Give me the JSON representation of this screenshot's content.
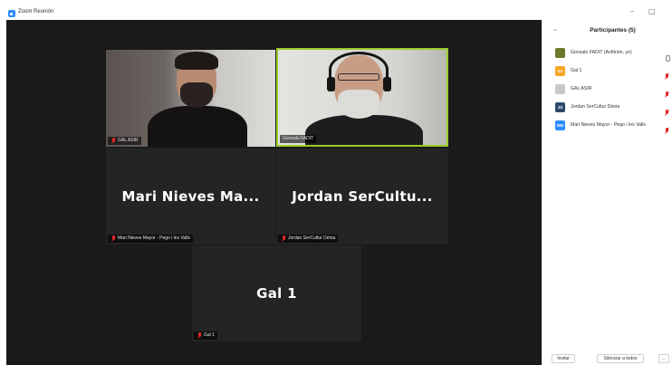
{
  "window": {
    "title": "Zoom Reunión",
    "minimize": "–",
    "maximize": "▢"
  },
  "tiles": {
    "top_left_label": "GAL ASIR",
    "top_right_label": "Gonzalo FADIT",
    "mid_left_name": "Mari Nieves Ma...",
    "mid_left_label": "Mari Nieves Mayor - Pego i les Valls",
    "mid_right_name": "Jordan SerCultu...",
    "mid_right_label": "Jordan SerCultur Dénia",
    "bottom_name": "Gal 1",
    "bottom_label": "Gal 1"
  },
  "panel": {
    "title": "Participantes (5)",
    "participants": [
      {
        "initials": "",
        "name": "Gonzalo FADIT (Anfitrión, yo)",
        "avatar_color": "#6b7a2a",
        "muted": false
      },
      {
        "initials": "G1",
        "name": "Gal 1",
        "avatar_color": "#f5a623",
        "muted": true
      },
      {
        "initials": "",
        "name": "GAL ASIR",
        "avatar_color": "#c9c9c9",
        "muted": true
      },
      {
        "initials": "JS",
        "name": "Jordan SerCultur Dénia",
        "avatar_color": "#2d4a6b",
        "muted": true
      },
      {
        "initials": "MN",
        "name": "Mari Nieves Mayor - Pego i les Valls",
        "avatar_color": "#2d8cff",
        "muted": true
      }
    ],
    "footer": {
      "invite": "Invitar",
      "mute_all": "Silenciar a todos",
      "more": "..."
    }
  },
  "colors": {
    "active_speaker": "#9ccb2b",
    "muted": "#e02828",
    "accent": "#2d8cff"
  }
}
